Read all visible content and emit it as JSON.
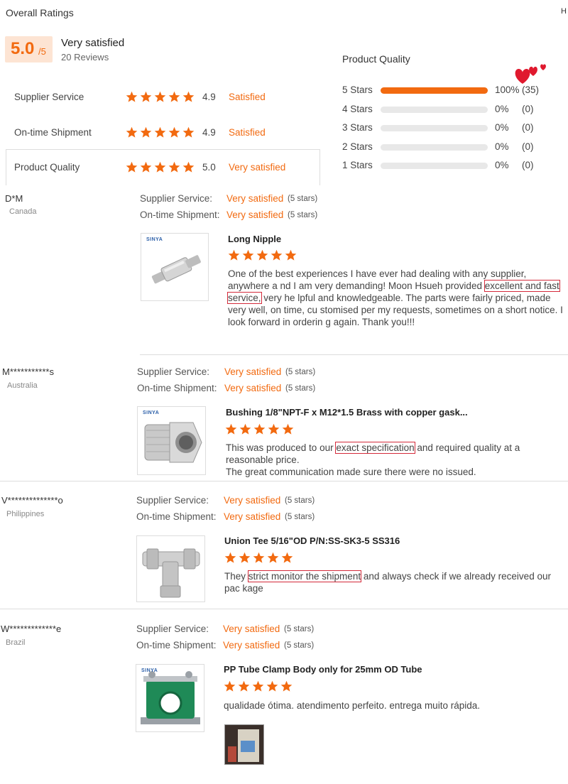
{
  "header": {
    "title": "Overall Ratings",
    "corner": "H"
  },
  "summary": {
    "score": "5.0",
    "score_suffix": "/5",
    "label": "Very satisfied",
    "reviews": "20 Reviews"
  },
  "category_ratings": [
    {
      "name": "Supplier Service",
      "value": "4.9",
      "text": "Satisfied"
    },
    {
      "name": "On-time Shipment",
      "value": "4.9",
      "text": "Satisfied"
    },
    {
      "name": "Product Quality",
      "value": "5.0",
      "text": "Very satisfied"
    }
  ],
  "quality": {
    "title": "Product Quality",
    "rows": [
      {
        "label": "5 Stars",
        "fraction": 1.0,
        "percent": "100%",
        "count": "(35)"
      },
      {
        "label": "4 Stars",
        "fraction": 0,
        "percent": "0%",
        "count": "(0)"
      },
      {
        "label": "3 Stars",
        "fraction": 0,
        "percent": "0%",
        "count": "(0)"
      },
      {
        "label": "2 Stars",
        "fraction": 0,
        "percent": "0%",
        "count": "(0)"
      },
      {
        "label": "1 Stars",
        "fraction": 0,
        "percent": "0%",
        "count": "(0)"
      }
    ]
  },
  "labels": {
    "supplier": "Supplier Service:",
    "shipment": "On-time Shipment:",
    "very_satisfied": "Very satisfied",
    "five_stars": "(5 stars)"
  },
  "reviews": [
    {
      "name": "D*M",
      "country": "Canada",
      "product": "Long Nipple",
      "brand": "SINYA",
      "text_before": "One of the best experiences I have ever had dealing with any supplier, anywhere a nd I am very demanding! Moon Hsueh provided ",
      "highlight": "excellent and fast service,",
      "text_after": " very he lpful and knowledgeable. The parts were fairly priced, made very well, on time, cu stomised per my requests, sometimes on a short notice. I look forward in orderin g again. Thank you!!!"
    },
    {
      "name": "M***********s",
      "country": "Australia",
      "product": "Bushing 1/8\"NPT-F x M12*1.5 Brass with copper gask...",
      "brand": "SINYA",
      "text_before": "This was produced to our ",
      "highlight": "exact specification",
      "text_after": " and required quality at a reasonable price.",
      "text_line2": "The great communication made sure there were no issued."
    },
    {
      "name": "V**************o",
      "country": "Philippines",
      "product": "Union Tee 5/16\"OD P/N:SS-SK3-5 SS316",
      "brand": "",
      "text_before": "They ",
      "highlight": "strict monitor the shipment",
      "text_after": " and always check if we already received our pac kage"
    },
    {
      "name": "W*************e",
      "country": "Brazil",
      "product": "PP Tube Clamp Body only for 25mm OD Tube",
      "brand": "SINYA",
      "text_before": "qualidade ótima. atendimento perfeito. entrega muito rápida.",
      "highlight": "",
      "text_after": ""
    }
  ]
}
